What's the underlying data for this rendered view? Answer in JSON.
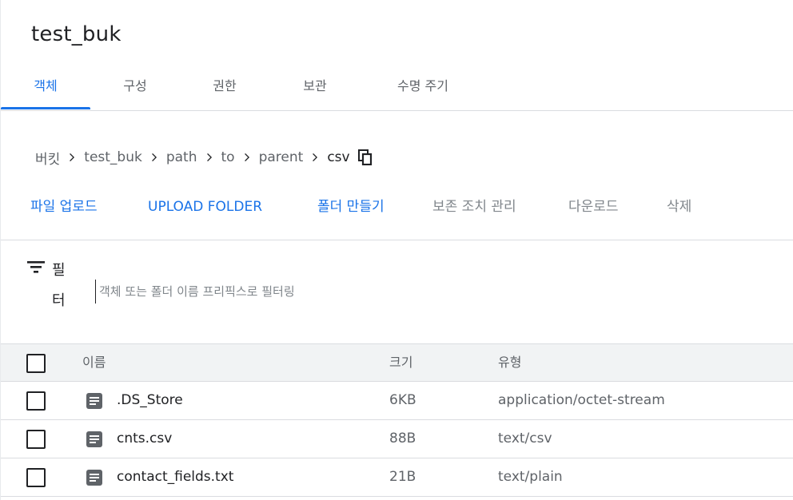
{
  "bucket": {
    "title": "test_buk"
  },
  "tabs": [
    {
      "label": "객체",
      "active": true
    },
    {
      "label": "구성",
      "active": false
    },
    {
      "label": "권한",
      "active": false
    },
    {
      "label": "보관",
      "active": false
    },
    {
      "label": "수명 주기",
      "active": false
    }
  ],
  "breadcrumb": {
    "items": [
      "버킷",
      "test_buk",
      "path",
      "to",
      "parent"
    ],
    "current": "csv",
    "copy_icon": "copy-icon"
  },
  "actions": {
    "upload_files": "파일 업로드",
    "upload_folder": "UPLOAD FOLDER",
    "create_folder": "폴더 만들기",
    "manage_holds": "보존 조치 관리",
    "download": "다운로드",
    "delete": "삭제"
  },
  "filter": {
    "label": "필터",
    "placeholder": "객체 또는 폴더 이름 프리픽스로 필터링",
    "icon": "filter-icon"
  },
  "table": {
    "headers": {
      "name": "이름",
      "size": "크기",
      "type": "유형"
    },
    "rows": [
      {
        "name": ".DS_Store",
        "size": "6KB",
        "type": "application/octet-stream"
      },
      {
        "name": "cnts.csv",
        "size": "88B",
        "type": "text/csv"
      },
      {
        "name": "contact_fields.txt",
        "size": "21B",
        "type": "text/plain"
      }
    ]
  },
  "colors": {
    "accent": "#1a73e8",
    "text": "#202124",
    "secondary": "#5f6368",
    "divider": "#dadce0",
    "header_bg": "#f1f3f4"
  }
}
